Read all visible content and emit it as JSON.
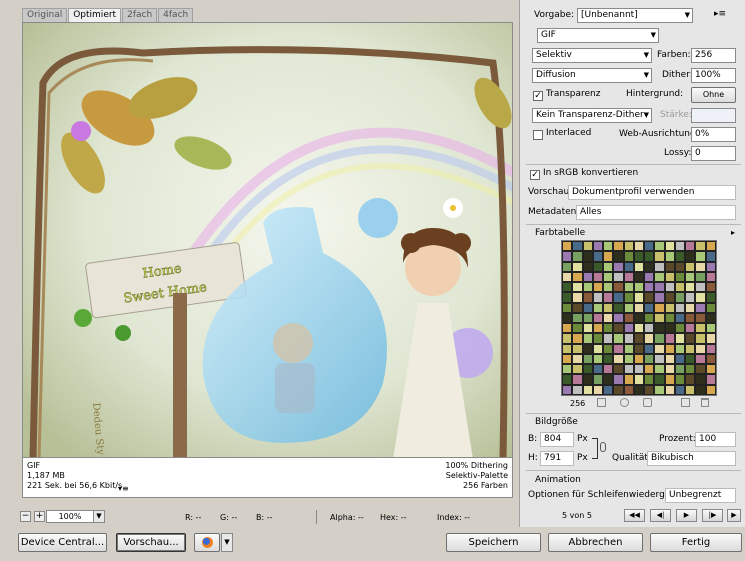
{
  "tabs": [
    "Original",
    "Optimiert",
    "2fach",
    "4fach"
  ],
  "preview": {
    "sign_line1": "Home",
    "sign_line2": "Sweet Home",
    "signature": "Dedeu Sty"
  },
  "info": {
    "format": "GIF",
    "size": "1,187 MB",
    "time": "221 Sek. bei 56,6 Kbit/s",
    "dithering": "100% Dithering",
    "palette": "Selektiv-Palette",
    "colors": "256 Farben"
  },
  "status": {
    "zoom": "100%",
    "r": "R: --",
    "g": "G: --",
    "b": "B: --",
    "alpha": "Alpha: --",
    "hex": "Hex: --",
    "index": "Index: --"
  },
  "buttons": {
    "device_central": "Device Central...",
    "preview": "Vorschau...",
    "save": "Speichern",
    "cancel": "Abbrechen",
    "done": "Fertig"
  },
  "settings": {
    "preset_label": "Vorgabe:",
    "preset_value": "[Unbenannt]",
    "format": "GIF",
    "reduction": "Selektiv",
    "colors_label": "Farben:",
    "colors_value": "256",
    "dither_algo": "Diffusion",
    "dither_label": "Dither:",
    "dither_value": "100%",
    "transparency_label": "Transparenz",
    "background_label": "Hintergrund:",
    "background_value": "Ohne",
    "trans_dither": "Kein Transparenz-Dither",
    "strength_label": "Stärke:",
    "interlaced_label": "Interlaced",
    "web_snap_label": "Web-Ausrichtung:",
    "web_snap_value": "0%",
    "lossy_label": "Lossy:",
    "lossy_value": "0",
    "srgb_label": "In sRGB konvertieren",
    "preview_label": "Vorschau:",
    "preview_value": "Dokumentprofil verwenden",
    "metadata_label": "Metadaten:",
    "metadata_value": "Alles"
  },
  "color_table": {
    "title": "Farbtabelle",
    "count": "256",
    "colors": [
      "#6b8a3a",
      "#c8c06a",
      "#2e2e1c",
      "#9a7ab0",
      "#e0e0a0",
      "#5a4a2a",
      "#a8c878",
      "#d8a850",
      "#4a6a8a",
      "#b87898",
      "#78a060",
      "#c0c0c0",
      "#8a5a3a",
      "#e8d8a8",
      "#3a5a2a"
    ]
  },
  "image_size": {
    "title": "Bildgröße",
    "w_label": "B:",
    "w_value": "804",
    "h_label": "H:",
    "h_value": "791",
    "unit": "Px",
    "percent_label": "Prozent:",
    "percent_value": "100",
    "quality_label": "Qualität:",
    "quality_value": "Bikubisch"
  },
  "animation": {
    "title": "Animation",
    "loop_label": "Optionen für Schleifenwiedergabe:",
    "loop_value": "Unbegrenzt",
    "frame": "5 von 5"
  }
}
